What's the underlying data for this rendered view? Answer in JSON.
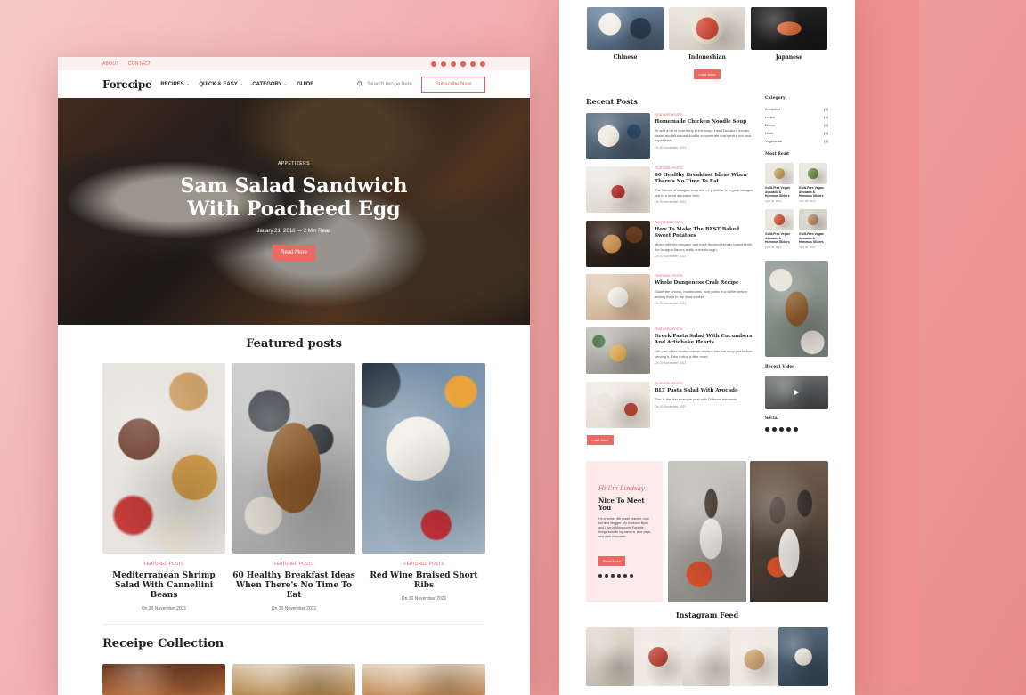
{
  "left": {
    "topbar": {
      "links": [
        "ABOUT",
        "CONTACT"
      ]
    },
    "nav": {
      "logo": "Forecipe",
      "menu": [
        "RECIPES",
        "QUICK & EASY",
        "CATEGORY",
        "GUIDE"
      ],
      "search_placeholder": "Search recipe here",
      "subscribe": "Subscribe Now"
    },
    "hero": {
      "category": "APPETIZERS",
      "title_line1": "Sam Salad Sandwich",
      "title_line2": "With Poacheed Egg",
      "meta": "Jauary 21, 2016  —  2 Min Read",
      "button": "Read More"
    },
    "featured": {
      "heading": "Featured posts",
      "cards": [
        {
          "tag": "FEATURED POSTS",
          "title": "Mediterranean Shrimp Salad With Cannellini Beans",
          "date": "On 30 November 2021"
        },
        {
          "tag": "FEATURED POSTS",
          "title": "60 Healthy Breakfast Ideas When There's No Time To Eat",
          "date": "On 30 November 2021"
        },
        {
          "tag": "FEATURED POSTS",
          "title": "Red Wine Braised Short Ribs",
          "date": "On 30 November 2021"
        }
      ]
    },
    "collection_heading": "Receipe Collection"
  },
  "right": {
    "cuisines": [
      "Chinese",
      "Indoneshian",
      "Japanese"
    ],
    "cuisine_button": "Load More",
    "recent_heading": "Recent Posts",
    "posts": [
      {
        "tag": "FEATURED POSTS",
        "title": "Homemade Chicken Noodle Soup",
        "excerpt": "To add a bit of bold body to the soup, I add DeLallo's tomato paste, and all natural double concentrate that's extra rich and super thick.",
        "date": "On 30 November 2021"
      },
      {
        "tag": "FEATURED POSTS",
        "title": "60 Healthy Breakfast Ideas When There's No Time To Eat",
        "excerpt": "The flavors of lasagna soup are very similar to regular lasagna, just in a more slurpable form.",
        "date": "On 30 November 2021"
      },
      {
        "tag": "FEATURED POSTS",
        "title": "How To Make The BEST Baked Sweet Potatoes",
        "excerpt": "Mixed with the oregano and basil flavored tomato based broth, the lasagna flavors really shine through.",
        "date": "On 30 November 2021"
      },
      {
        "tag": "FEATURED POSTS",
        "title": "Whole Dungeness Crab Recipe",
        "excerpt": "Sauté the onions, mushrooms, and garlic in a skillet before adding them to the slow cooker.",
        "date": "On 30 November 2021"
      },
      {
        "tag": "FEATURED POSTS",
        "title": "Greek Pasta Salad With Cucumbers And Artichoke Hearts",
        "excerpt": "Get part of the ricotta cheese mixture into the soup just before serving it, then dollop a little more.",
        "date": "On 30 November 2021"
      },
      {
        "tag": "FEATURED POSTS",
        "title": "BLT Pasta Salad With Avocado",
        "excerpt": "This is the first example post with Different elements.",
        "date": "On 30 November 2021"
      }
    ],
    "posts_button": "Load More",
    "sidebar": {
      "category_heading": "Category",
      "categories": [
        {
          "name": "Breakfast",
          "count": "(3)"
        },
        {
          "name": "Lunch",
          "count": "(3)"
        },
        {
          "name": "Dinner",
          "count": "(3)"
        },
        {
          "name": "Drink",
          "count": "(3)"
        },
        {
          "name": "Vegetarian",
          "count": "(3)"
        }
      ],
      "most_read_heading": "Most Read",
      "most_read": [
        {
          "title": "Guilt-Free Vegan Avocado & Hummus Sliders",
          "date": "April 28, 2022"
        },
        {
          "title": "Guilt-Free Vegan Avocado & Hummus Sliders",
          "date": "April 28, 2022"
        },
        {
          "title": "Guilt-Free Vegan Avocado & Hummus Sliders",
          "date": "April 28, 2022"
        },
        {
          "title": "Guilt-Free Vegan Avocado & Hummus Sliders",
          "date": "April 28, 2022"
        }
      ],
      "recent_video_heading": "Recent Video",
      "social_heading": "Social"
    },
    "about": {
      "signature": "Hi I'm Lindsay",
      "heading": "Nice To Meet You",
      "text": "I'm a former 4th grade teacher, now full time blogger. My husband Bjork and I live in Minnesota. Favorite things include my camera, lake days, and dark chocolate.",
      "button": "Read More"
    },
    "instagram_heading": "Instagram Feed"
  },
  "colors": {
    "accent": "#e86a61",
    "brand_pink": "#f0a6a6"
  }
}
